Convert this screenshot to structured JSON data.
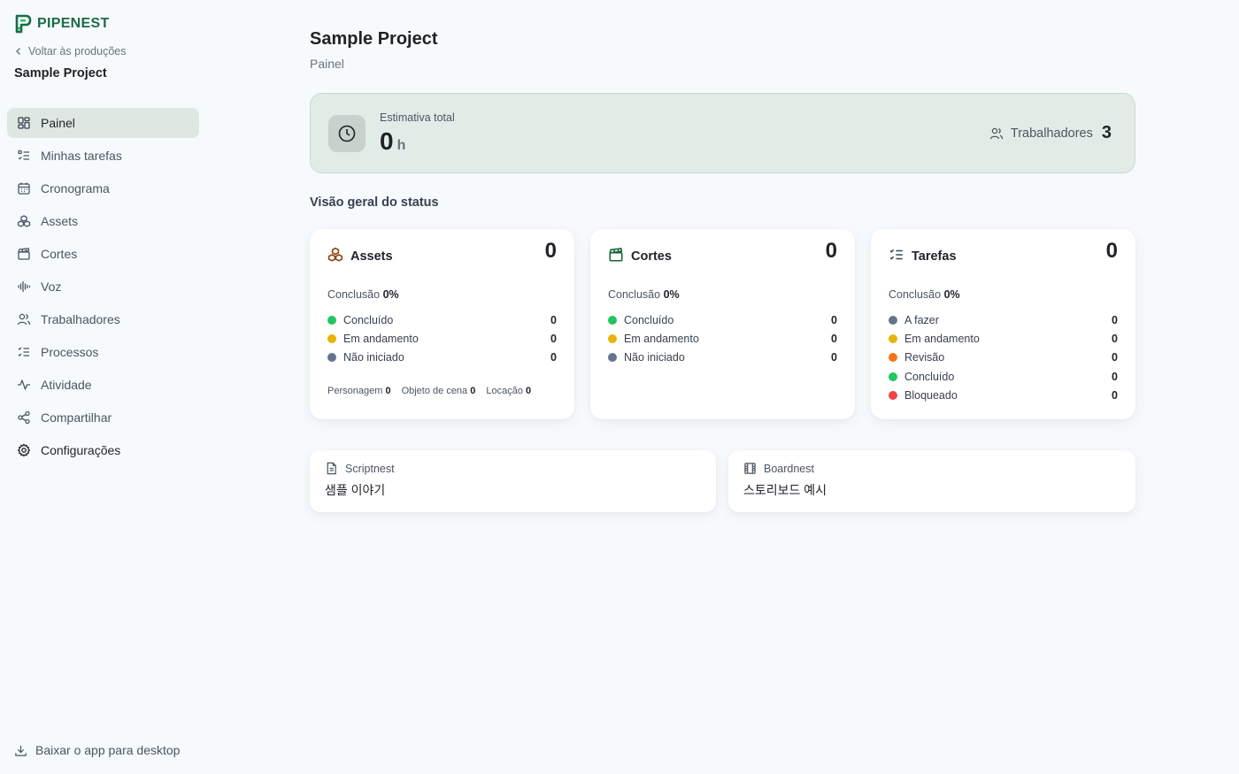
{
  "app": {
    "name": "PIPENEST",
    "brand_color": "#1a6b47"
  },
  "sidebar": {
    "back_label": "Voltar às produções",
    "project_name": "Sample Project",
    "items": [
      {
        "label": "Painel",
        "icon": "dashboard-icon",
        "active": true
      },
      {
        "label": "Minhas tarefas",
        "icon": "task-list-icon"
      },
      {
        "label": "Cronograma",
        "icon": "calendar-icon"
      },
      {
        "label": "Assets",
        "icon": "assets-icon"
      },
      {
        "label": "Cortes",
        "icon": "clapperboard-icon"
      },
      {
        "label": "Voz",
        "icon": "audio-wave-icon"
      },
      {
        "label": "Trabalhadores",
        "icon": "users-icon"
      },
      {
        "label": "Processos",
        "icon": "checklist-icon"
      },
      {
        "label": "Atividade",
        "icon": "activity-icon"
      },
      {
        "label": "Compartilhar",
        "icon": "share-icon"
      },
      {
        "label": "Configurações",
        "icon": "gear-icon"
      }
    ],
    "download_label": "Baixar o app para desktop"
  },
  "header": {
    "title": "Sample Project",
    "subtitle": "Painel"
  },
  "estimate": {
    "label": "Estimativa total",
    "value": "0",
    "unit": "h",
    "workers_label": "Trabalhadores",
    "workers_count": "3"
  },
  "status": {
    "title": "Visão geral do status",
    "completion_label": "Conclusão",
    "colors": {
      "green": "#22c55e",
      "yellow": "#eab308",
      "gray": "#64748b",
      "orange": "#f97316",
      "red": "#ef4444"
    },
    "cards": [
      {
        "title": "Assets",
        "total": "0",
        "completion": "0%",
        "rows": [
          {
            "label": "Concluído",
            "value": "0",
            "color": "#22c55e"
          },
          {
            "label": "Em andamento",
            "value": "0",
            "color": "#eab308"
          },
          {
            "label": "Não iniciado",
            "value": "0",
            "color": "#64748b"
          }
        ],
        "footer": [
          {
            "label": "Personagem",
            "value": "0"
          },
          {
            "label": "Objeto de cena",
            "value": "0"
          },
          {
            "label": "Locação",
            "value": "0"
          }
        ]
      },
      {
        "title": "Cortes",
        "total": "0",
        "completion": "0%",
        "rows": [
          {
            "label": "Concluído",
            "value": "0",
            "color": "#22c55e"
          },
          {
            "label": "Em andamento",
            "value": "0",
            "color": "#eab308"
          },
          {
            "label": "Não iniciado",
            "value": "0",
            "color": "#64748b"
          }
        ]
      },
      {
        "title": "Tarefas",
        "total": "0",
        "completion": "0%",
        "rows": [
          {
            "label": "A fazer",
            "value": "0",
            "color": "#64748b"
          },
          {
            "label": "Em andamento",
            "value": "0",
            "color": "#eab308"
          },
          {
            "label": "Revisão",
            "value": "0",
            "color": "#f97316"
          },
          {
            "label": "Concluído",
            "value": "0",
            "color": "#22c55e"
          },
          {
            "label": "Bloqueado",
            "value": "0",
            "color": "#ef4444"
          }
        ]
      }
    ]
  },
  "links": [
    {
      "label": "Scriptnest",
      "name": "샘플 이야기",
      "icon": "document-icon"
    },
    {
      "label": "Boardnest",
      "name": "스토리보드 예시",
      "icon": "film-icon"
    }
  ]
}
